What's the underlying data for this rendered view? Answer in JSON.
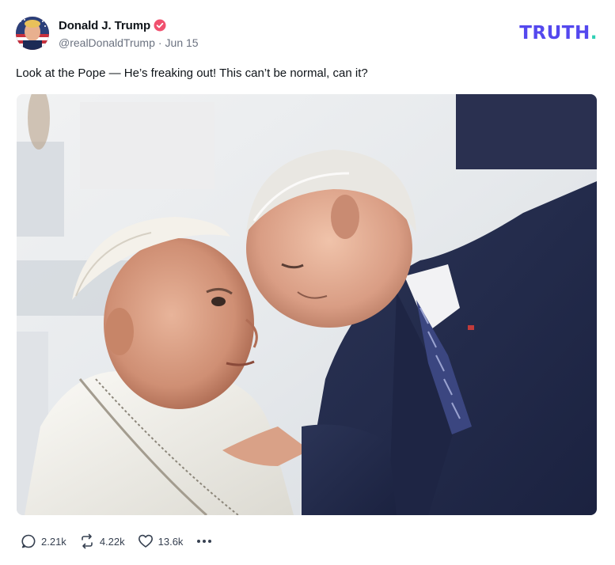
{
  "post": {
    "author": {
      "display_name": "Donald J. Trump",
      "handle": "@realDonaldTrump",
      "separator": "·",
      "date": "Jun 15",
      "verified_icon": "verified-badge-icon",
      "verified_color": "#f0506e"
    },
    "brand": {
      "wordmark": "TRUTH",
      "dot": ".",
      "color": "#5448ee",
      "dot_color": "#2fd0b5"
    },
    "text": "Look at the Pope — He’s freaking out! This can’t be normal, can it?",
    "image": {
      "alt_icon": "photo-icon"
    },
    "actions": {
      "replies": {
        "icon": "reply-icon",
        "count": "2.21k"
      },
      "retruths": {
        "icon": "retruth-icon",
        "count": "4.22k"
      },
      "likes": {
        "icon": "heart-icon",
        "count": "13.6k"
      },
      "more": {
        "icon": "more-icon"
      }
    }
  }
}
